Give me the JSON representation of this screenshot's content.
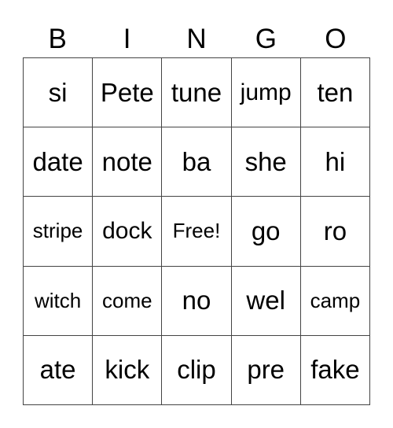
{
  "header": [
    "B",
    "I",
    "N",
    "G",
    "O"
  ],
  "cells": [
    [
      "si",
      "Pete",
      "tune",
      "jump",
      "ten"
    ],
    [
      "date",
      "note",
      "ba",
      "she",
      "hi"
    ],
    [
      "stripe",
      "dock",
      "Free!",
      "go",
      "ro"
    ],
    [
      "witch",
      "come",
      "no",
      "wel",
      "camp"
    ],
    [
      "ate",
      "kick",
      "clip",
      "pre",
      "fake"
    ]
  ]
}
